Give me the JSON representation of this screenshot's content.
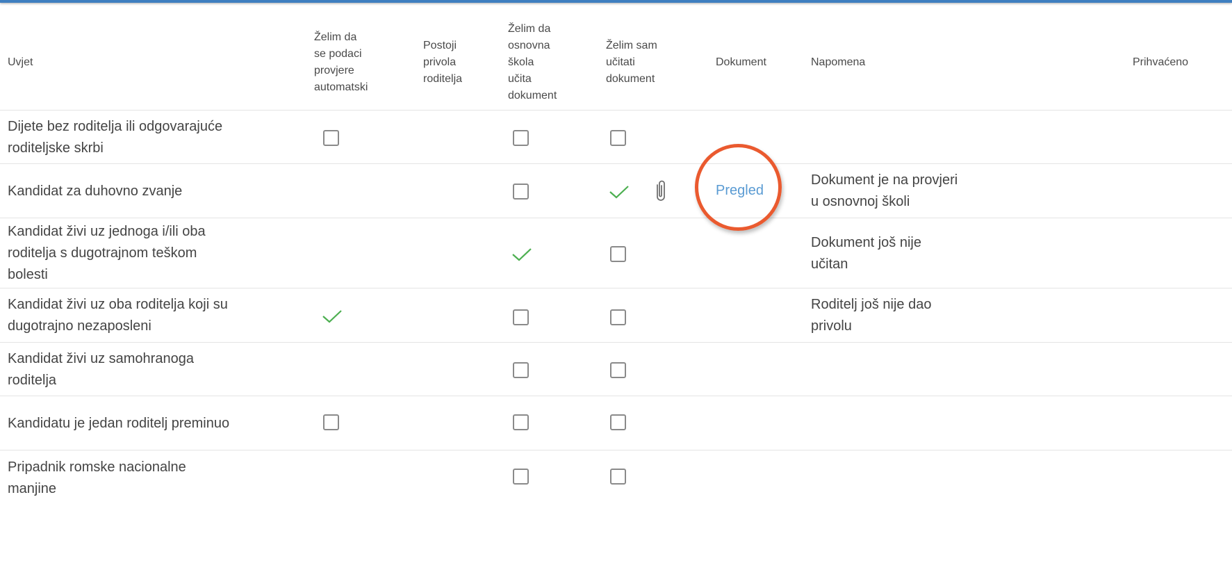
{
  "table": {
    "headers": [
      "Uvjet",
      "Želim da\nse podaci\nprovjere\nautomatski",
      "Postoji\nprivola\nroditelja",
      "Želim da\nosnovna\nškola\nučita\ndokument",
      "Želim sam\nučitati\ndokument",
      "Dokument",
      "Napomena",
      "Prihvaćeno"
    ],
    "rows": [
      {
        "condition": "Dijete bez roditelja ili odgovarajuće\nroditeljske skrbi",
        "auto": "checkbox-unchecked",
        "school_upload": "checkbox-unchecked",
        "self_upload": "checkbox-unchecked",
        "document": "",
        "note": ""
      },
      {
        "condition": "Kandidat za duhovno zvanje",
        "auto": "",
        "school_upload": "checkbox-unchecked",
        "self_upload": "check",
        "attachment": "paperclip-icon",
        "document": "Pregled",
        "note": "Dokument je na provjeri\nu osnovnoj školi"
      },
      {
        "condition": "Kandidat živi uz jednoga i/ili oba\nroditelja s dugotrajnom teškom\nbolesti",
        "auto": "",
        "school_upload": "check",
        "self_upload": "checkbox-unchecked",
        "document": "",
        "note": "Dokument još nije\nučitan"
      },
      {
        "condition": "Kandidat živi uz oba roditelja koji su\ndugotrajno nezaposleni",
        "auto": "check",
        "school_upload": "checkbox-unchecked",
        "self_upload": "checkbox-unchecked",
        "document": "",
        "note": "Roditelj još nije dao\nprivolu"
      },
      {
        "condition": "Kandidat živi uz samohranoga\nroditelja",
        "auto": "",
        "school_upload": "checkbox-unchecked",
        "self_upload": "checkbox-unchecked",
        "document": "",
        "note": ""
      },
      {
        "condition": "Kandidatu je jedan roditelj preminuo",
        "auto": "checkbox-unchecked",
        "school_upload": "checkbox-unchecked",
        "self_upload": "checkbox-unchecked",
        "document": "",
        "note": ""
      },
      {
        "condition": "Pripadnik romske nacionalne\nmanjine",
        "auto": "",
        "school_upload": "checkbox-unchecked",
        "self_upload": "checkbox-unchecked",
        "document": "",
        "note": ""
      }
    ]
  },
  "colors": {
    "accent_bar": "#3f7fc0",
    "link": "#5a9bd3",
    "check": "#4caf50",
    "highlight_circle": "#ea5a2f"
  }
}
